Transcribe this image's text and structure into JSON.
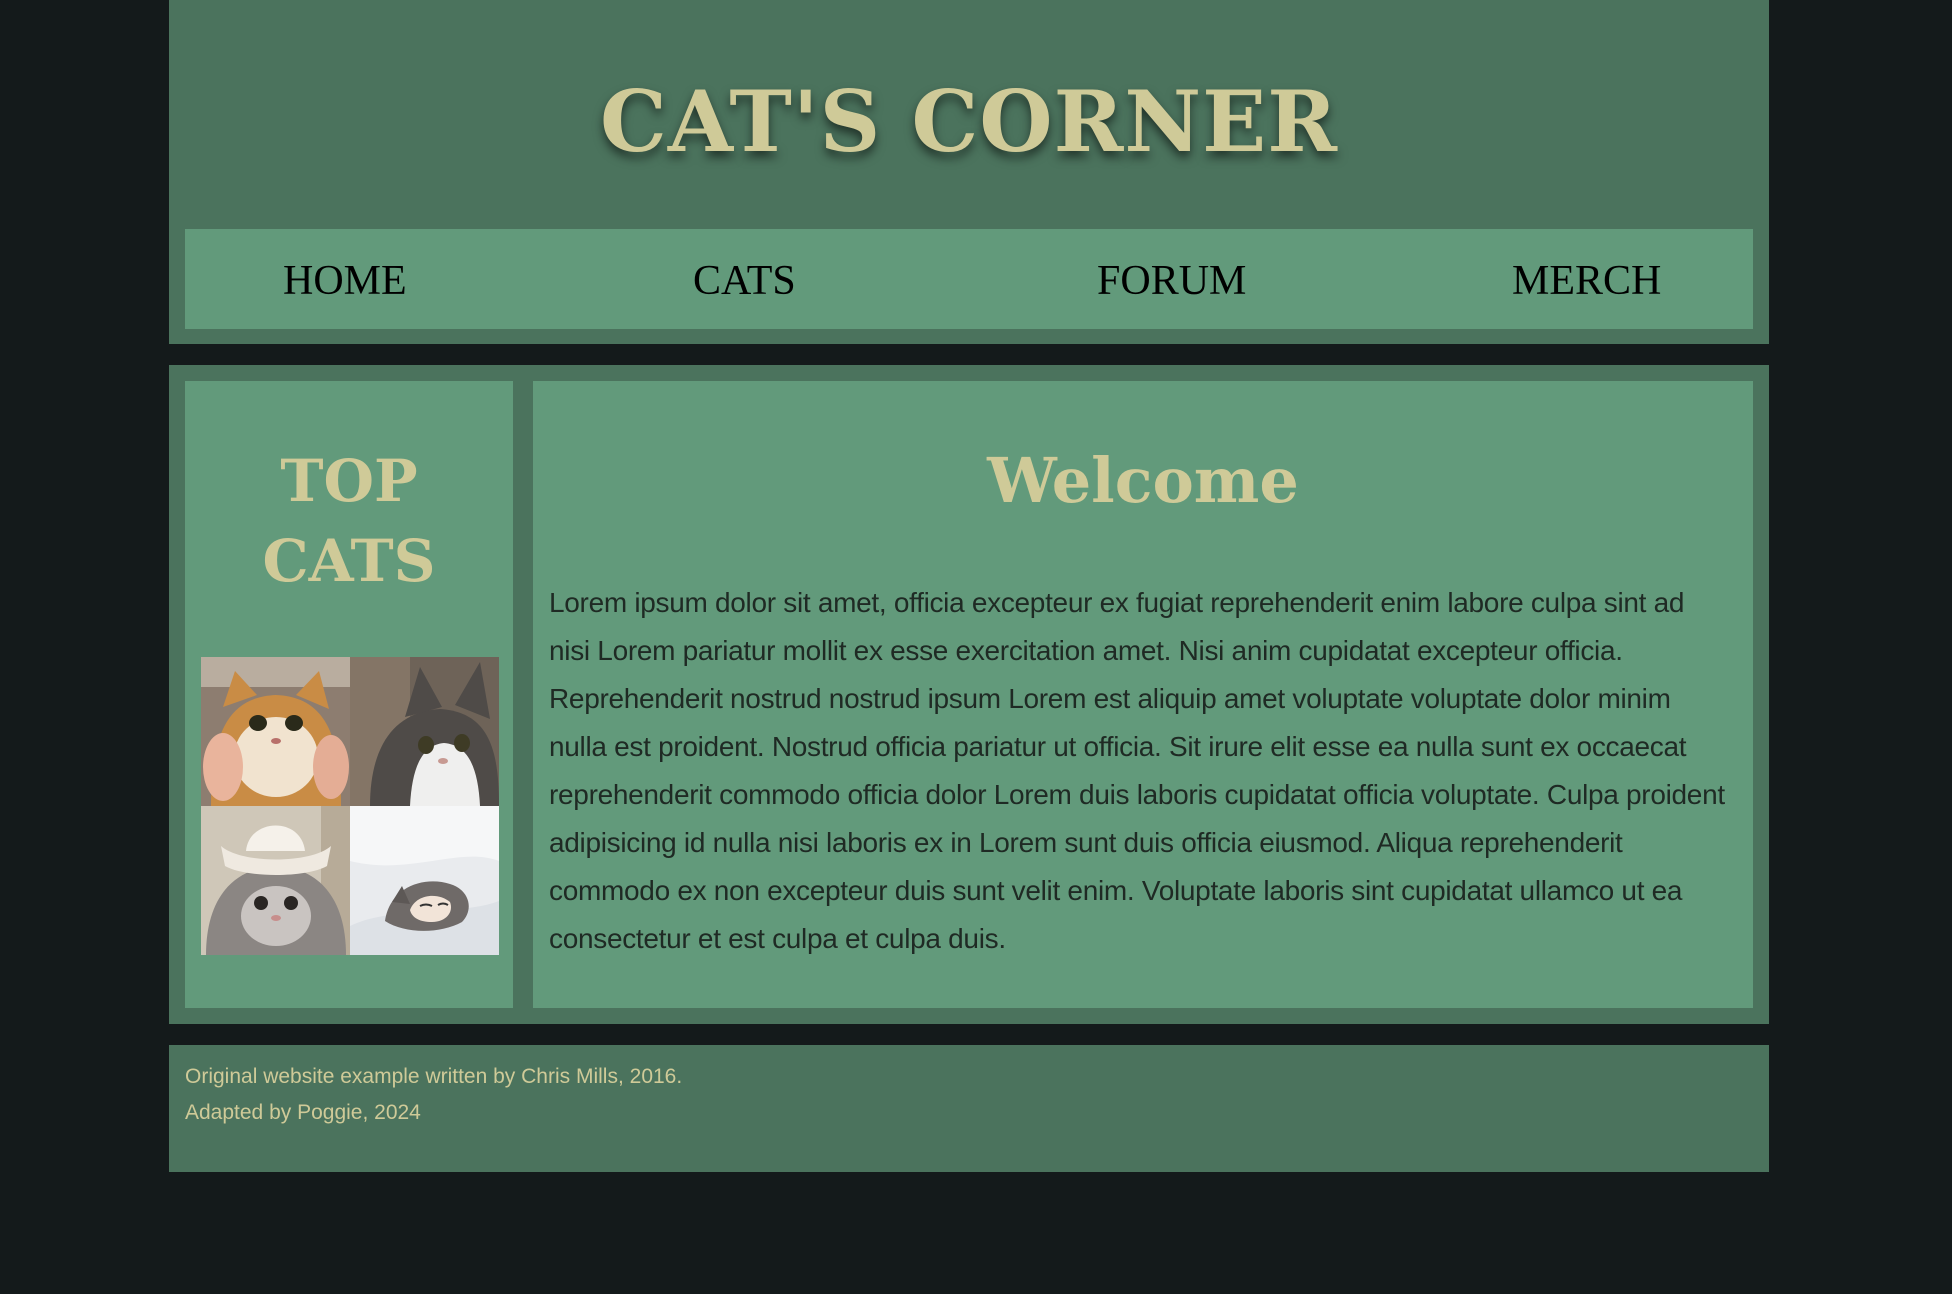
{
  "header": {
    "title": "CAT'S CORNER"
  },
  "nav": {
    "items": [
      {
        "label": "HOME"
      },
      {
        "label": "CATS"
      },
      {
        "label": "FORUM"
      },
      {
        "label": "MERCH"
      }
    ]
  },
  "aside": {
    "title_line1": "TOP",
    "title_line2": "CATS",
    "images": [
      {
        "name": "ginger-cat-photo"
      },
      {
        "name": "tabby-white-cat-photo"
      },
      {
        "name": "fluffy-cat-cowboy-hat-photo"
      },
      {
        "name": "sleeping-cat-blanket-photo"
      }
    ]
  },
  "article": {
    "heading": "Welcome",
    "body": "Lorem ipsum dolor sit amet, officia excepteur ex fugiat reprehenderit enim labore culpa sint ad nisi Lorem pariatur mollit ex esse exercitation amet. Nisi anim cupidatat excepteur officia. Reprehenderit nostrud nostrud ipsum Lorem est aliquip amet voluptate voluptate dolor minim nulla est proident. Nostrud officia pariatur ut officia. Sit irure elit esse ea nulla sunt ex occaecat reprehenderit commodo officia dolor Lorem duis laboris cupidatat officia voluptate. Culpa proident adipisicing id nulla nisi laboris ex in Lorem sunt duis officia eiusmod. Aliqua reprehenderit commodo ex non excepteur duis sunt velit enim. Voluptate laboris sint cupidatat ullamco ut ea consectetur et est culpa et culpa duis."
  },
  "footer": {
    "line1": "Original website example written by Chris Mills, 2016.",
    "line2": "Adapted by Poggie, 2024"
  },
  "colors": {
    "page_bg": "#141a1b",
    "panel": "#4b735d",
    "panel_light": "#629a7b",
    "accent_text": "#cfca98"
  }
}
